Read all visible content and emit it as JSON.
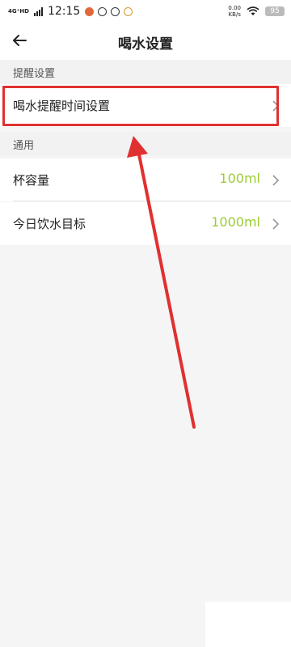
{
  "status_bar": {
    "network_type": "4G⁺HD",
    "time": "12:15",
    "net_speed_value": "0.00",
    "net_speed_unit": "KB/s",
    "battery": "95"
  },
  "nav": {
    "title": "喝水设置"
  },
  "sections": [
    {
      "header": "提醒设置",
      "items": [
        {
          "label": "喝水提醒时间设置",
          "value": ""
        }
      ]
    },
    {
      "header": "通用",
      "items": [
        {
          "label": "杯容量",
          "value": "100ml"
        },
        {
          "label": "今日饮水目标",
          "value": "1000ml"
        }
      ]
    }
  ],
  "colors": {
    "accent_value": "#9acd32",
    "annotation_red": "#e03030",
    "background": "#f5f5f5"
  },
  "icons": {
    "back": "arrow-left-icon",
    "chevron": "chevron-right-icon",
    "wifi": "wifi-icon"
  }
}
